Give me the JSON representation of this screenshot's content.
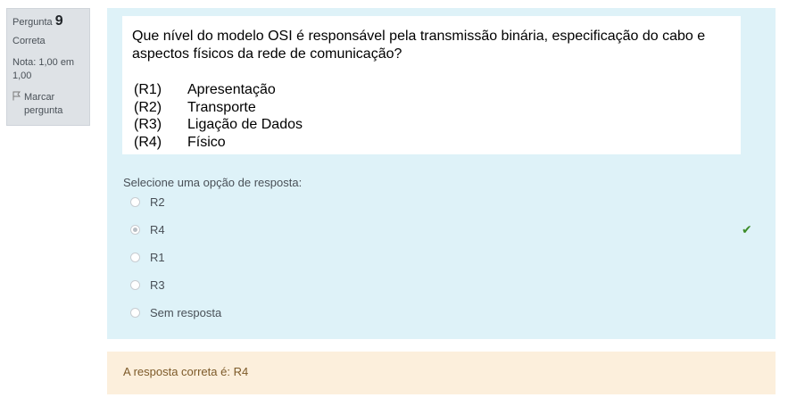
{
  "info": {
    "question_word": "Pergunta",
    "question_number": "9",
    "state": "Correta",
    "grade": "Nota: 1,00 em 1,00",
    "flag_icon": "flag-icon",
    "flag_label": "Marcar pergunta"
  },
  "question": {
    "text": "Que nível do modelo OSI é responsável pela transmissão binária, especificação do cabo e aspectos físicos da rede de comunicação?",
    "options": [
      {
        "code": "(R1)",
        "text": "Apresentação"
      },
      {
        "code": "(R2)",
        "text": "Transporte"
      },
      {
        "code": "(R3)",
        "text": "Ligação de Dados"
      },
      {
        "code": "(R4)",
        "text": "Físico"
      }
    ]
  },
  "prompt": "Selecione uma opção de resposta:",
  "answers": [
    {
      "label": "R2",
      "selected": false
    },
    {
      "label": "R4",
      "selected": true,
      "correct_icon": "checkmark-icon"
    },
    {
      "label": "R1",
      "selected": false
    },
    {
      "label": "R3",
      "selected": false
    },
    {
      "label": "Sem resposta",
      "selected": false
    }
  ],
  "feedback": "A resposta correta é: R4",
  "colors": {
    "formulation_bg": "#def2f8",
    "feedback_bg": "#fcefdc",
    "info_bg": "#dee2e6",
    "correct_check": "#3c8c28"
  }
}
